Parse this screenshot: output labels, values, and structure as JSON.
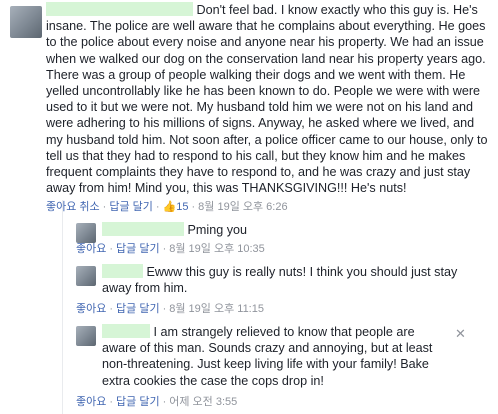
{
  "comments": [
    {
      "text": "Don't feel bad. I know exactly who this guy is. He's insane. The police are well aware that he complains about everything. He goes to the police about every noise and anyone near his property. We had an issue when we walked our dog on the conservation land near his property years ago. There was a group of people walking their dogs and we went with them. He yelled uncontrollably like he has been known to do. People we were with were used to it but we were not. My husband told him we were not on his land and were adhering to his millions of signs. Anyway, he asked where we lived, and my husband told him. Not soon after, a police officer came to our house, only to tell us that they had to respond to his call, but they know him and he makes frequent complaints they have to respond to, and he was crazy and just stay away from him! Mind you, this was THANKSGIVING!!! He's nuts!",
      "like_label": "좋아요 취소",
      "reply_label": "답글 달기",
      "reaction_count": "15",
      "timestamp": "8월 19일 오후 6:26"
    },
    {
      "text": "Pming you",
      "like_label": "좋아요",
      "reply_label": "답글 달기",
      "timestamp": "8월 19일 오후 10:35"
    },
    {
      "text": "Ewww this guy is really nuts! I think you should just stay away from him.",
      "like_label": "좋아요",
      "reply_label": "답글 달기",
      "timestamp": "8월 19일 오후 11:15"
    },
    {
      "text": "I am strangely relieved to know that people are aware of this man. Sounds crazy and annoying, but at least non-threatening. Just keep living life with your family! Bake extra cookies the case the cops drop in!",
      "like_label": "좋아요",
      "reply_label": "답글 달기",
      "timestamp": "어제 오전 3:55"
    }
  ],
  "separator": "·",
  "icons": {
    "reaction": "thumbs-up-icon",
    "remove": "close-icon"
  },
  "colors": {
    "link": "#4267b2",
    "meta": "#90949c",
    "redaction": "#d6f5d6"
  }
}
